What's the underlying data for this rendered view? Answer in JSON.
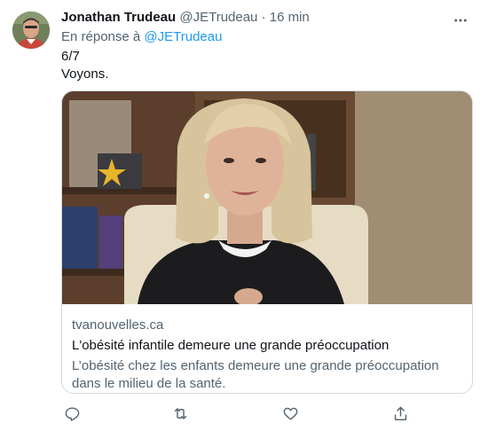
{
  "tweet": {
    "author": {
      "display_name": "Jonathan Trudeau",
      "handle": "@JETrudeau",
      "separator": "·",
      "time": "16 min"
    },
    "reply": {
      "prefix": "En réponse à",
      "mention": "@JETrudeau"
    },
    "text_lines": [
      "6/7",
      "Voyons."
    ],
    "card": {
      "domain": "tvanouvelles.ca",
      "title": "L'obésité infantile demeure une grande préoccupation",
      "description": "L’obésité chez les enfants demeure une grande préoccupation dans le milieu de la santé."
    },
    "icons": {
      "more": "more-horizontal-icon",
      "reply": "reply-icon",
      "retweet": "retweet-icon",
      "like": "heart-icon",
      "share": "share-icon"
    },
    "colors": {
      "text": "#0f1419",
      "secondary": "#536471",
      "link": "#1d9bf0",
      "border": "#cfd9de"
    }
  }
}
